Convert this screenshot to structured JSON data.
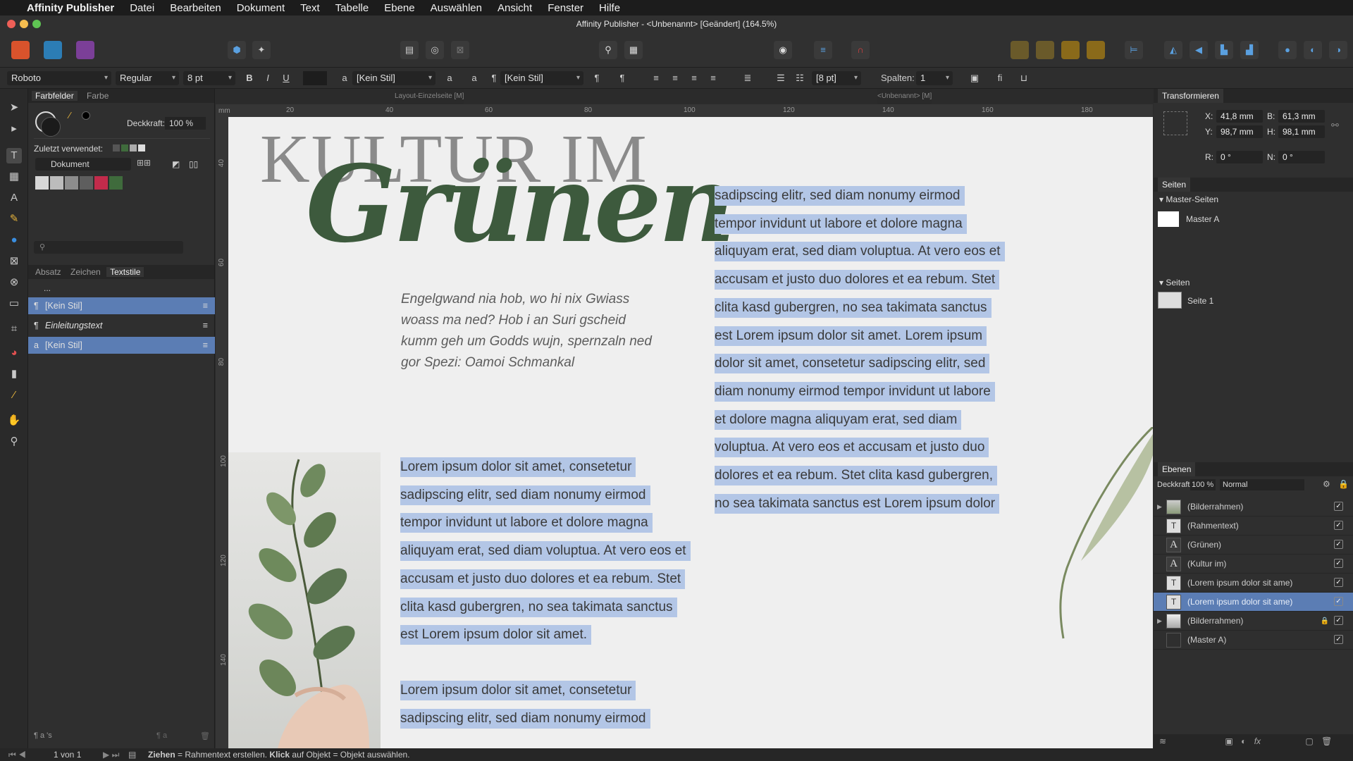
{
  "menubar": {
    "apple": "",
    "app": "Affinity Publisher",
    "items": [
      "Datei",
      "Bearbeiten",
      "Dokument",
      "Text",
      "Tabelle",
      "Ebene",
      "Auswählen",
      "Ansicht",
      "Fenster",
      "Hilfe"
    ]
  },
  "window": {
    "title": "Affinity Publisher - <Unbenannt> [Geändert] (164.5%)"
  },
  "context_toolbar": {
    "font": "Roboto",
    "weight": "Regular",
    "size": "8 pt",
    "bold": "B",
    "italic": "I",
    "underline": "U",
    "char_style": "[Kein Stil]",
    "para_style": "[Kein Stil]",
    "spacing": "[8 pt]",
    "columns_label": "Spalten:",
    "columns_value": "1"
  },
  "doc_tabs": {
    "left": "Layout-Einzelseite [M]",
    "right": "<Unbenannt> [M]"
  },
  "left_panel": {
    "tabs": [
      "Farbfelder",
      "Farbe"
    ],
    "opacity_label": "Deckkraft:",
    "opacity_value": "100 %",
    "recent_label": "Zuletzt verwendet:",
    "palette": "Dokument",
    "swatches": [
      "#d7d7d7",
      "#bcbcbc",
      "#8d8d8d",
      "#5e5e5e",
      "#c22b4b",
      "#3f6b3c"
    ],
    "search_placeholder": "",
    "style_tabs": [
      "Absatz",
      "Zeichen",
      "Textstile"
    ],
    "styles_header": "...",
    "styles": [
      {
        "icon": "¶",
        "label": "[Kein Stil]",
        "selected": true,
        "italic": false
      },
      {
        "icon": "¶",
        "label": "Einleitungstext",
        "selected": false,
        "italic": true
      },
      {
        "icon": "a",
        "label": "[Kein Stil]",
        "selected": true,
        "italic": false
      }
    ]
  },
  "ruler": {
    "unit": "mm",
    "h_ticks": [
      "20",
      "40",
      "60",
      "80",
      "100",
      "120",
      "140",
      "160",
      "180"
    ],
    "v_ticks": [
      "40",
      "60",
      "80",
      "100",
      "120",
      "140"
    ]
  },
  "page": {
    "headline": "KULTUR IM",
    "script": "Grünen",
    "intro": "Engelgwand nia hob, wo hi nix Gwiass woass ma ned? Hob i an Suri gscheid kumm geh um Godds wujn, spernzaln ned gor Spezi: Oamoi Schmankal",
    "col_right": [
      "sadipscing elitr, sed diam nonumy eirmod",
      "tempor invidunt ut labore et dolore magna",
      "aliquyam erat, sed diam voluptua. At vero eos et",
      "accusam et justo duo dolores et ea rebum. Stet",
      "clita kasd gubergren, no sea takimata sanctus",
      "est Lorem ipsum dolor sit amet. Lorem ipsum",
      "dolor sit amet, consetetur sadipscing elitr, sed",
      "diam nonumy eirmod tempor invidunt ut labore",
      "et dolore magna aliquyam erat, sed diam",
      "voluptua. At vero eos et accusam et justo duo",
      "dolores et ea rebum. Stet clita kasd gubergren,",
      "no sea takimata sanctus est Lorem ipsum dolor"
    ],
    "col_left_a": [
      "Lorem ipsum dolor sit amet, consetetur",
      "sadipscing elitr, sed diam nonumy eirmod",
      "tempor invidunt ut labore et dolore magna",
      "aliquyam erat, sed diam voluptua. At vero eos et",
      "accusam et justo duo dolores et ea rebum. Stet",
      "clita kasd gubergren, no sea takimata sanctus",
      "est Lorem ipsum dolor sit amet."
    ],
    "col_left_b": [
      "Lorem ipsum dolor sit amet, consetetur",
      "sadipscing elitr, sed diam nonumy eirmod"
    ]
  },
  "transform": {
    "title": "Transformieren",
    "x_label": "X:",
    "x": "41,8 mm",
    "y_label": "Y:",
    "y": "98,7 mm",
    "b_label": "B:",
    "b": "61,3 mm",
    "h_label": "H:",
    "h": "98,1 mm",
    "r_label": "R:",
    "r": "0 °",
    "n_label": "N:",
    "n": "0 °"
  },
  "pages_panel": {
    "title": "Seiten",
    "master_section": "Master-Seiten",
    "master_item": "Master A",
    "pages_section": "Seiten",
    "page_item": "Seite 1"
  },
  "layers_panel": {
    "title": "Ebenen",
    "opacity_label": "Deckkraft:",
    "opacity_value": "100 %",
    "blend": "Normal",
    "layers": [
      {
        "name": "(Bilderrahmen)",
        "thumb": "img",
        "expand": true,
        "selected": false,
        "locked": false
      },
      {
        "name": "(Rahmentext)",
        "thumb": "T",
        "expand": false,
        "selected": false,
        "locked": false
      },
      {
        "name": "(Grünen)",
        "thumb": "A",
        "expand": false,
        "selected": false,
        "locked": false
      },
      {
        "name": "(Kultur im)",
        "thumb": "A",
        "expand": false,
        "selected": false,
        "locked": false
      },
      {
        "name": "(Lorem ipsum dolor sit ame)",
        "thumb": "T",
        "expand": false,
        "selected": false,
        "locked": false
      },
      {
        "name": "(Lorem ipsum dolor sit ame)",
        "thumb": "T",
        "expand": false,
        "selected": true,
        "locked": false
      },
      {
        "name": "(Bilderrahmen)",
        "thumb": "img2",
        "expand": true,
        "selected": false,
        "locked": true
      },
      {
        "name": "(Master A)",
        "thumb": "",
        "expand": false,
        "selected": false,
        "locked": false
      }
    ]
  },
  "status": {
    "page": "1 von 1",
    "hint_bold1": "Ziehen",
    "hint1": " = Rahmentext erstellen. ",
    "hint_bold2": "Klick",
    "hint2": " auf Objekt = Objekt auswählen."
  }
}
